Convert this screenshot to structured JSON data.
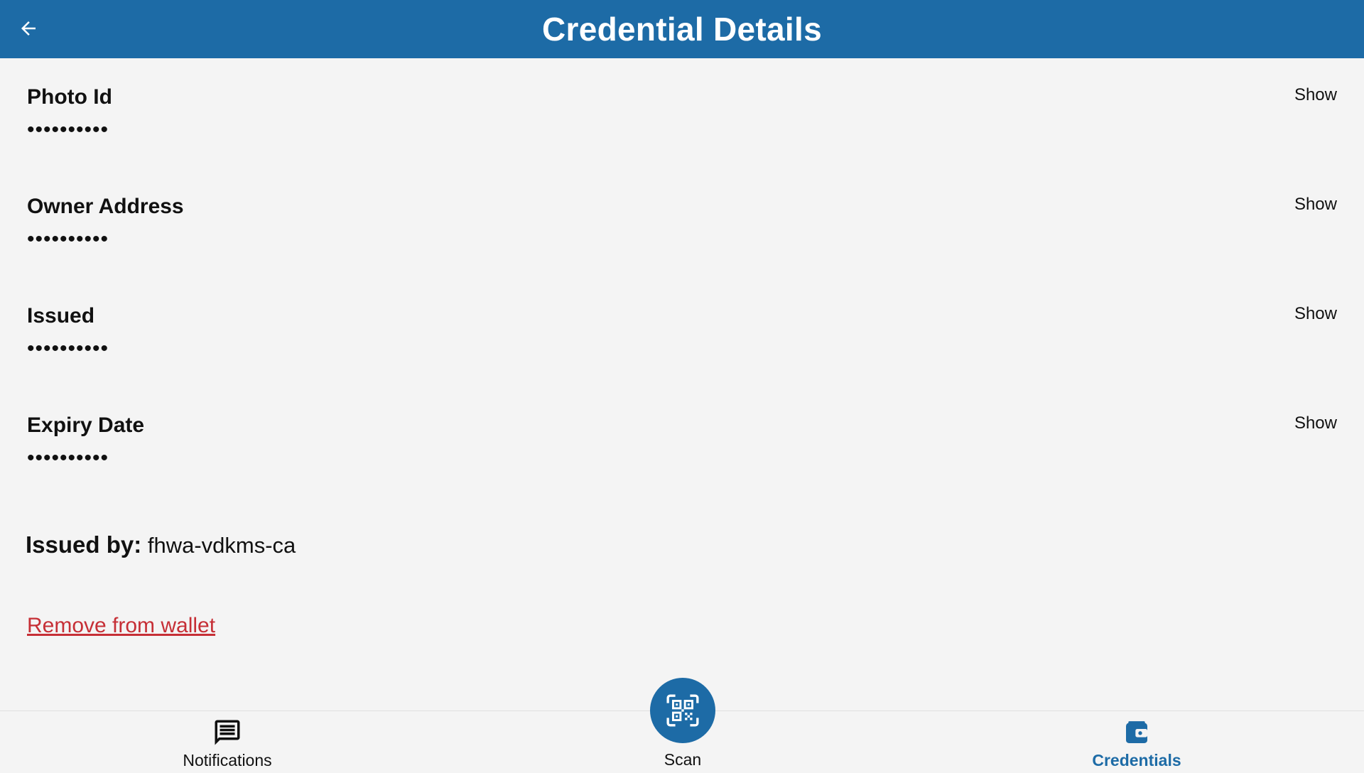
{
  "header": {
    "title": "Credential Details",
    "back_icon": "arrow-left-icon"
  },
  "fields": [
    {
      "label": "Photo Id",
      "value": "••••••••••",
      "action": "Show"
    },
    {
      "label": "Owner Address",
      "value": "••••••••••",
      "action": "Show"
    },
    {
      "label": "Issued",
      "value": "••••••••••",
      "action": "Show"
    },
    {
      "label": "Expiry Date",
      "value": "••••••••••",
      "action": "Show"
    }
  ],
  "issuer": {
    "label": "Issued by:",
    "value": "fhwa-vdkms-ca"
  },
  "remove_label": "Remove from wallet",
  "bottom_nav": {
    "notifications": {
      "label": "Notifications",
      "icon": "message-icon"
    },
    "scan": {
      "label": "Scan",
      "icon": "qr-code-icon"
    },
    "credentials": {
      "label": "Credentials",
      "icon": "wallet-icon",
      "active": true
    }
  },
  "colors": {
    "primary": "#1d6ba6",
    "background": "#f4f4f4",
    "danger": "#c62f36"
  }
}
